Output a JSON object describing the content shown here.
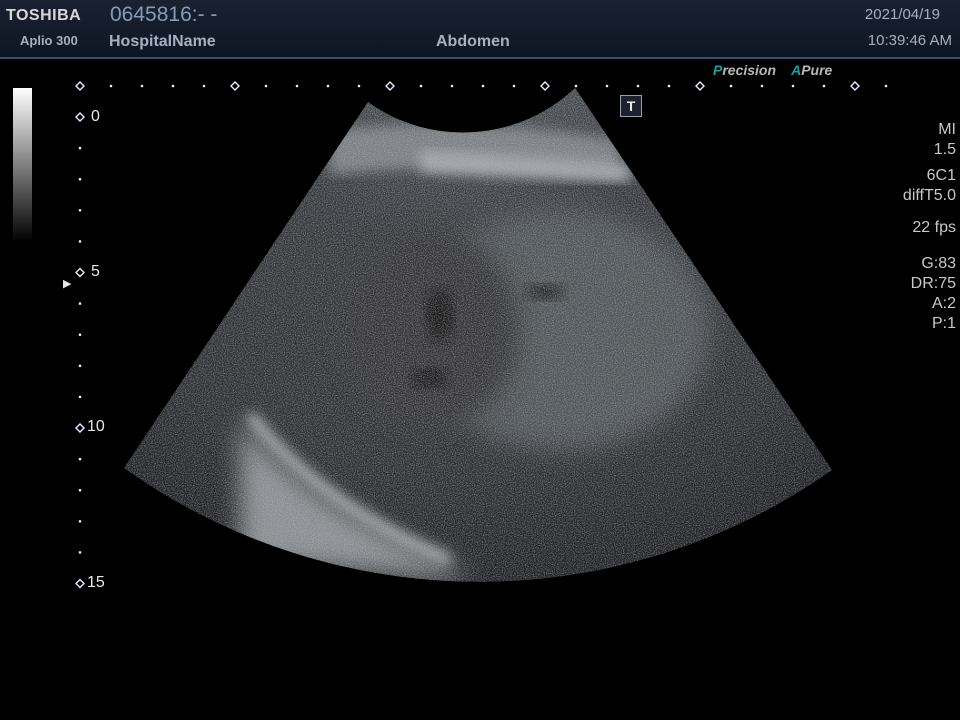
{
  "header": {
    "brand": "TOSHIBA",
    "model": "Aplio 300",
    "patient_id": "0645816:- -",
    "hospital": "HospitalName",
    "preset": "Abdomen",
    "date": "2021/04/19",
    "time": "10:39:46 AM"
  },
  "modes": {
    "precision_letter": "P",
    "precision_rest": "recision",
    "apure_letter": "A",
    "apure_rest": "Pure"
  },
  "overlay": {
    "t_marker": "T",
    "focus_marker": "▶"
  },
  "params": {
    "mi_label": "MI",
    "mi_value": "1.5",
    "probe": "6C1",
    "mode": "diffT5.0",
    "fps": "22 fps",
    "gain": "G:83",
    "dynamic_range": "DR:75",
    "a": "A:2",
    "p": "P:1"
  },
  "depth_scale": {
    "labels": [
      "0",
      "5",
      "10",
      "15"
    ]
  }
}
